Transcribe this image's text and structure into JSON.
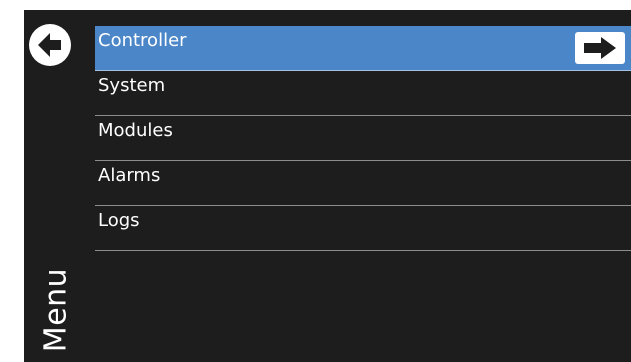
{
  "title": "Menu",
  "menu": {
    "items": [
      {
        "label": "Controller",
        "selected": true
      },
      {
        "label": "System",
        "selected": false
      },
      {
        "label": "Modules",
        "selected": false
      },
      {
        "label": "Alarms",
        "selected": false
      },
      {
        "label": "Logs",
        "selected": false
      }
    ]
  },
  "icons": {
    "back": "back-arrow-circle-icon",
    "go": "right-arrow-icon"
  },
  "colors": {
    "background": "#1d1d1d",
    "selected_row": "#4a86c8",
    "text": "#ffffff",
    "divider": "#8c8c8c"
  }
}
